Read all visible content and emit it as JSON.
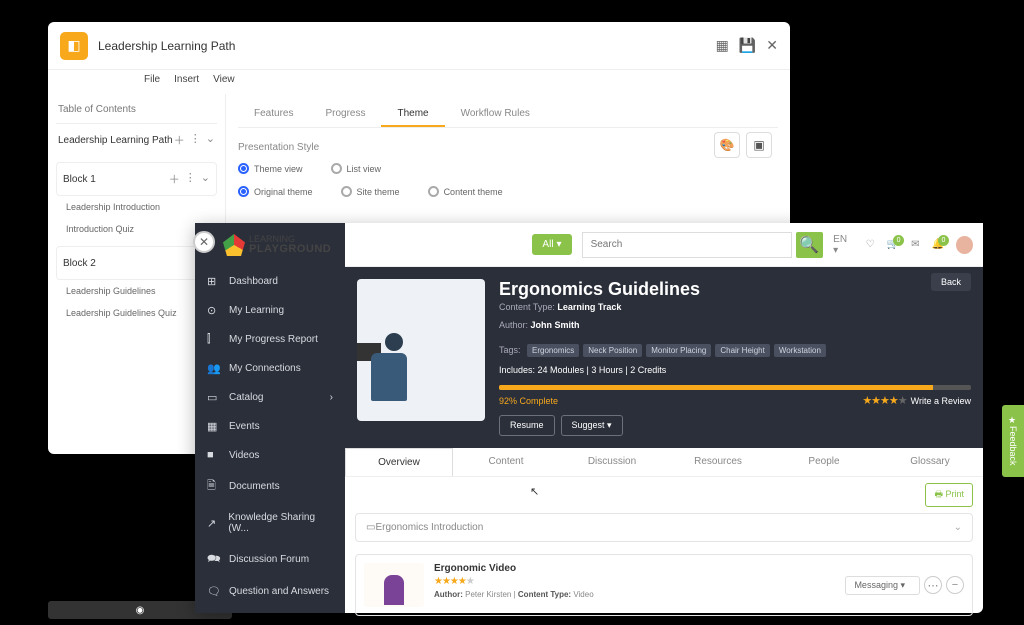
{
  "win1": {
    "title": "Leadership Learning Path",
    "menu": [
      "File",
      "Insert",
      "View"
    ],
    "toc_label": "Table of Contents",
    "path_name": "Leadership Learning Path",
    "block1": "Block 1",
    "block1_items": [
      "Leadership Introduction",
      "Introduction Quiz"
    ],
    "block2": "Block 2",
    "block2_items": [
      "Leadership Guidelines",
      "Leadership Guidelines Quiz"
    ],
    "tabs": [
      "Features",
      "Progress",
      "Theme",
      "Workflow Rules"
    ],
    "pres_label": "Presentation Style",
    "view_opts": [
      "Theme view",
      "List view"
    ],
    "theme_opts": [
      "Original theme",
      "Site theme",
      "Content theme"
    ]
  },
  "win2": {
    "logo_top": "LEARNING",
    "logo_bottom": "PLAYGROUND",
    "all_btn": "All",
    "search_placeholder": "Search",
    "lang": "EN",
    "cart_badge": "0",
    "bell_badge": "0",
    "sidebar": [
      {
        "icon": "⊞",
        "label": "Dashboard"
      },
      {
        "icon": "⊙",
        "label": "My Learning"
      },
      {
        "icon": "⫿",
        "label": "My Progress Report"
      },
      {
        "icon": "👥",
        "label": "My Connections"
      },
      {
        "icon": "▭",
        "label": "Catalog",
        "chevron": "›"
      },
      {
        "icon": "▦",
        "label": "Events"
      },
      {
        "icon": "■",
        "label": "Videos"
      },
      {
        "icon": "🗎",
        "label": "Documents"
      },
      {
        "icon": "↗",
        "label": "Knowledge Sharing (W..."
      },
      {
        "icon": "🗪",
        "label": "Discussion Forum"
      },
      {
        "icon": "🗨",
        "label": "Question and Answers"
      }
    ],
    "hero": {
      "title": "Ergonomics Guidelines",
      "content_type_label": "Content Type:",
      "content_type": "Learning Track",
      "author_label": "Author:",
      "author": "John Smith",
      "tags_label": "Tags:",
      "tags": [
        "Ergonomics",
        "Neck Position",
        "Monitor Placing",
        "Chair Height",
        "Workstation"
      ],
      "includes": "Includes: 24 Modules | 3 Hours | 2 Credits",
      "progress_pct": "92% Complete",
      "write_review": "Write a Review",
      "resume": "Resume",
      "suggest": "Suggest",
      "back": "Back"
    },
    "ctabs": [
      "Overview",
      "Content",
      "Discussion",
      "Resources",
      "People",
      "Glossary"
    ],
    "print": "Print",
    "accordion": "Ergonomics Introduction",
    "item": {
      "title": "Ergonomic Video",
      "author_lbl": "Author:",
      "author": "Peter Kirsten",
      "ctype_lbl": "Content Type:",
      "ctype": "Video",
      "messaging": "Messaging"
    },
    "feedback": "Feedback"
  }
}
